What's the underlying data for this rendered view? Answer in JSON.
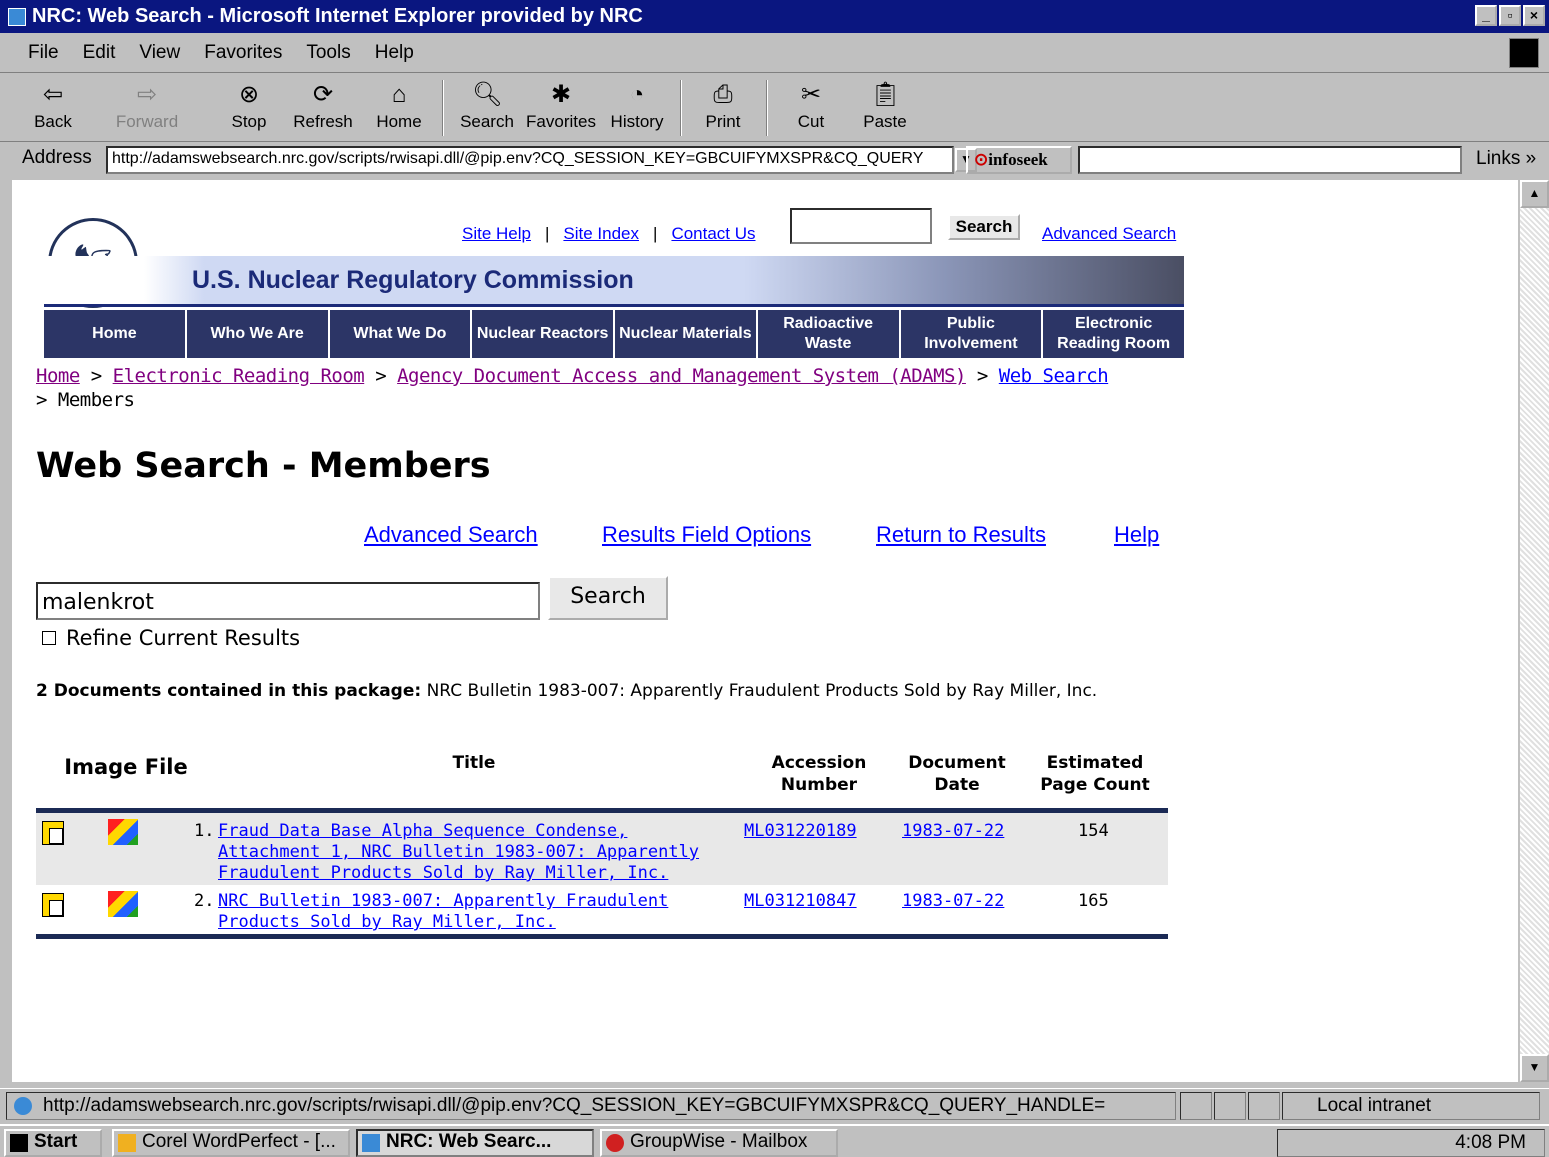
{
  "window": {
    "title": "NRC: Web Search - Microsoft Internet Explorer provided by NRC"
  },
  "menu": [
    "File",
    "Edit",
    "View",
    "Favorites",
    "Tools",
    "Help"
  ],
  "toolbar": {
    "back": "Back",
    "forward": "Forward",
    "stop": "Stop",
    "refresh": "Refresh",
    "home": "Home",
    "search": "Search",
    "favorites": "Favorites",
    "history": "History",
    "print": "Print",
    "cut": "Cut",
    "paste": "Paste"
  },
  "address": {
    "label": "Address",
    "url": "http://adamswebsearch.nrc.gov/scripts/rwisapi.dll/@pip.env?CQ_SESSION_KEY=GBCUIFYMXSPR&CQ_QUERY",
    "infoseek": "infoseek",
    "links": "Links"
  },
  "header": {
    "site_help": "Site Help",
    "site_index": "Site Index",
    "contact_us": "Contact Us",
    "search_button": "Search",
    "advanced_search": "Advanced Search",
    "banner_title": "U.S. Nuclear Regulatory Commission"
  },
  "nav": [
    "Home",
    "Who We Are",
    "What We Do",
    "Nuclear Reactors",
    "Nuclear Materials",
    "Radioactive Waste",
    "Public Involvement",
    "Electronic Reading Room"
  ],
  "breadcrumb": {
    "home": "Home",
    "err": "Electronic Reading Room",
    "adams": "Agency Document Access and Management System (ADAMS)",
    "web_search": "Web Search",
    "current": "Members",
    "sep": ">"
  },
  "page_title": "Web Search - Members",
  "top_links": {
    "advanced": "Advanced Search",
    "results_field": "Results Field Options",
    "return": "Return to Results",
    "help": "Help"
  },
  "query": {
    "value": "malenkrot",
    "button": "Search",
    "refine_label": "Refine Current Results"
  },
  "package": {
    "label": "2 Documents contained in this package:",
    "text": "NRC Bulletin 1983-007: Apparently Fraudulent Products Sold by Ray Miller, Inc."
  },
  "table": {
    "headers": {
      "image": "Image File",
      "title": "Title",
      "accession": "Accession Number",
      "date": "Document Date",
      "pages": "Estimated Page Count"
    },
    "rows": [
      {
        "num": "1.",
        "title_l1": "Fraud Data Base Alpha Sequence Condense,",
        "title_l2": "Attachment 1, NRC Bulletin 1983-007: Apparently",
        "title_l3": "Fraudulent Products Sold by Ray Miller, Inc.",
        "accession": "ML031220189",
        "date": "1983-07-22",
        "pages": "154"
      },
      {
        "num": "2.",
        "title_l1": "NRC Bulletin 1983-007: Apparently Fraudulent",
        "title_l2": "Products Sold by Ray Miller, Inc.",
        "title_l3": "",
        "accession": "ML031210847",
        "date": "1983-07-22",
        "pages": "165"
      }
    ]
  },
  "status": {
    "url": "http://adamswebsearch.nrc.gov/scripts/rwisapi.dll/@pip.env?CQ_SESSION_KEY=GBCUIFYMXSPR&CQ_QUERY_HANDLE=",
    "zone": "Local intranet"
  },
  "taskbar": {
    "start": "Start",
    "wp": "Corel WordPerfect - [...",
    "ie": "NRC: Web Searc...",
    "gw": "GroupWise - Mailbox",
    "clock": "4:08 PM"
  }
}
